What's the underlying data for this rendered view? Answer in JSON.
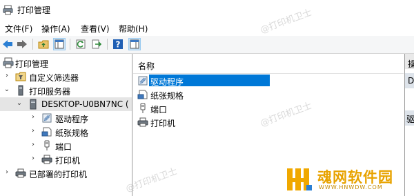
{
  "window": {
    "title": "打印管理"
  },
  "menu": [
    {
      "label": "文件(F)"
    },
    {
      "label": "操作(A)"
    },
    {
      "label": "查看(V)"
    },
    {
      "label": "帮助(H)"
    }
  ],
  "toolbar": {
    "buttons": [
      "back-arrow-icon",
      "forward-arrow-icon",
      "folder-up-icon",
      "show-hide-tree-icon",
      "refresh-icon",
      "export-list-icon",
      "help-icon",
      "show-hide-action-pane-icon"
    ]
  },
  "tree": {
    "root": "打印管理",
    "items": [
      {
        "label": "自定义筛选器",
        "icon": "filter-folder-icon"
      },
      {
        "label": "打印服务器",
        "icon": "print-servers-icon"
      },
      {
        "label": "DESKTOP-U0BN7NC (",
        "icon": "computer-icon"
      },
      {
        "label": "驱动程序",
        "icon": "drivers-icon"
      },
      {
        "label": "纸张规格",
        "icon": "forms-icon"
      },
      {
        "label": "端口",
        "icon": "port-icon"
      },
      {
        "label": "打印机",
        "icon": "printer-icon"
      },
      {
        "label": "已部署的打印机",
        "icon": "deployed-printers-icon"
      }
    ]
  },
  "list": {
    "column_header": "名称",
    "rows": [
      {
        "label": "驱动程序",
        "icon": "drivers-icon"
      },
      {
        "label": "纸张规格",
        "icon": "forms-icon"
      },
      {
        "label": "端口",
        "icon": "port-icon"
      },
      {
        "label": "打印机",
        "icon": "printer-icon"
      }
    ]
  },
  "actions": {
    "header": "操",
    "item1": "D",
    "item2": "驱"
  },
  "watermark": {
    "text": "@打印机卫士"
  },
  "logo": {
    "name": "魂网软件园",
    "url": "WWW.HNWDW.COM"
  },
  "colors": {
    "selection": "#0078d7",
    "logo": "#e8a300"
  }
}
